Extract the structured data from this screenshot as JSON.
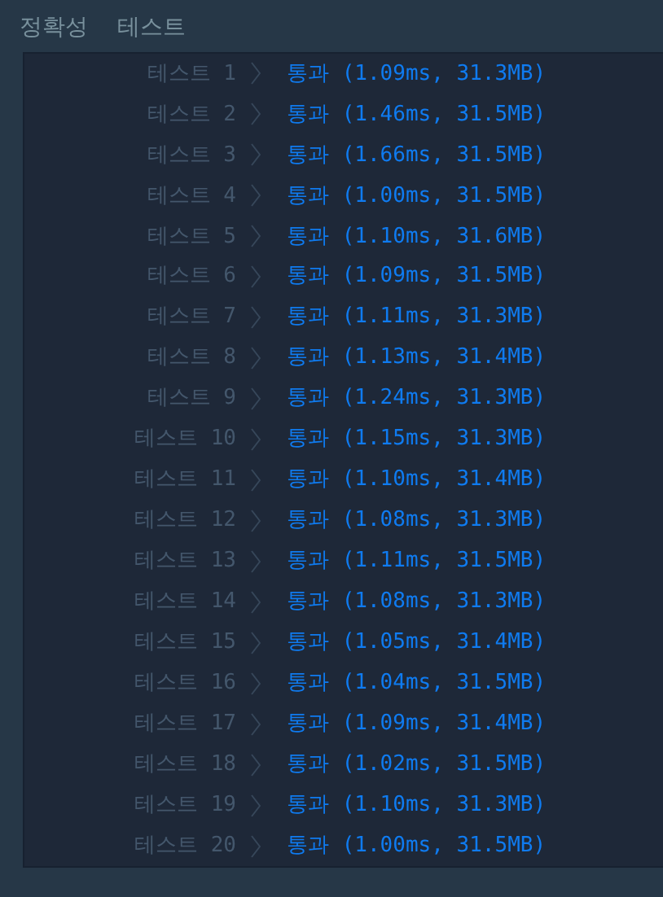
{
  "tabs": [
    {
      "label": "정확성"
    },
    {
      "label": "테스트"
    }
  ],
  "results": [
    {
      "label": "테스트 1",
      "result": "통과 (1.09ms, 31.3MB)"
    },
    {
      "label": "테스트 2",
      "result": "통과 (1.46ms, 31.5MB)"
    },
    {
      "label": "테스트 3",
      "result": "통과 (1.66ms, 31.5MB)"
    },
    {
      "label": "테스트 4",
      "result": "통과 (1.00ms, 31.5MB)"
    },
    {
      "label": "테스트 5",
      "result": "통과 (1.10ms, 31.6MB)"
    },
    {
      "label": "테스트 6",
      "result": "통과 (1.09ms, 31.5MB)"
    },
    {
      "label": "테스트 7",
      "result": "통과 (1.11ms, 31.3MB)"
    },
    {
      "label": "테스트 8",
      "result": "통과 (1.13ms, 31.4MB)"
    },
    {
      "label": "테스트 9",
      "result": "통과 (1.24ms, 31.3MB)"
    },
    {
      "label": "테스트 10",
      "result": "통과 (1.15ms, 31.3MB)"
    },
    {
      "label": "테스트 11",
      "result": "통과 (1.10ms, 31.4MB)"
    },
    {
      "label": "테스트 12",
      "result": "통과 (1.08ms, 31.3MB)"
    },
    {
      "label": "테스트 13",
      "result": "통과 (1.11ms, 31.5MB)"
    },
    {
      "label": "테스트 14",
      "result": "통과 (1.08ms, 31.3MB)"
    },
    {
      "label": "테스트 15",
      "result": "통과 (1.05ms, 31.4MB)"
    },
    {
      "label": "테스트 16",
      "result": "통과 (1.04ms, 31.5MB)"
    },
    {
      "label": "테스트 17",
      "result": "통과 (1.09ms, 31.4MB)"
    },
    {
      "label": "테스트 18",
      "result": "통과 (1.02ms, 31.5MB)"
    },
    {
      "label": "테스트 19",
      "result": "통과 (1.10ms, 31.3MB)"
    },
    {
      "label": "테스트 20",
      "result": "통과 (1.00ms, 31.5MB)"
    }
  ]
}
